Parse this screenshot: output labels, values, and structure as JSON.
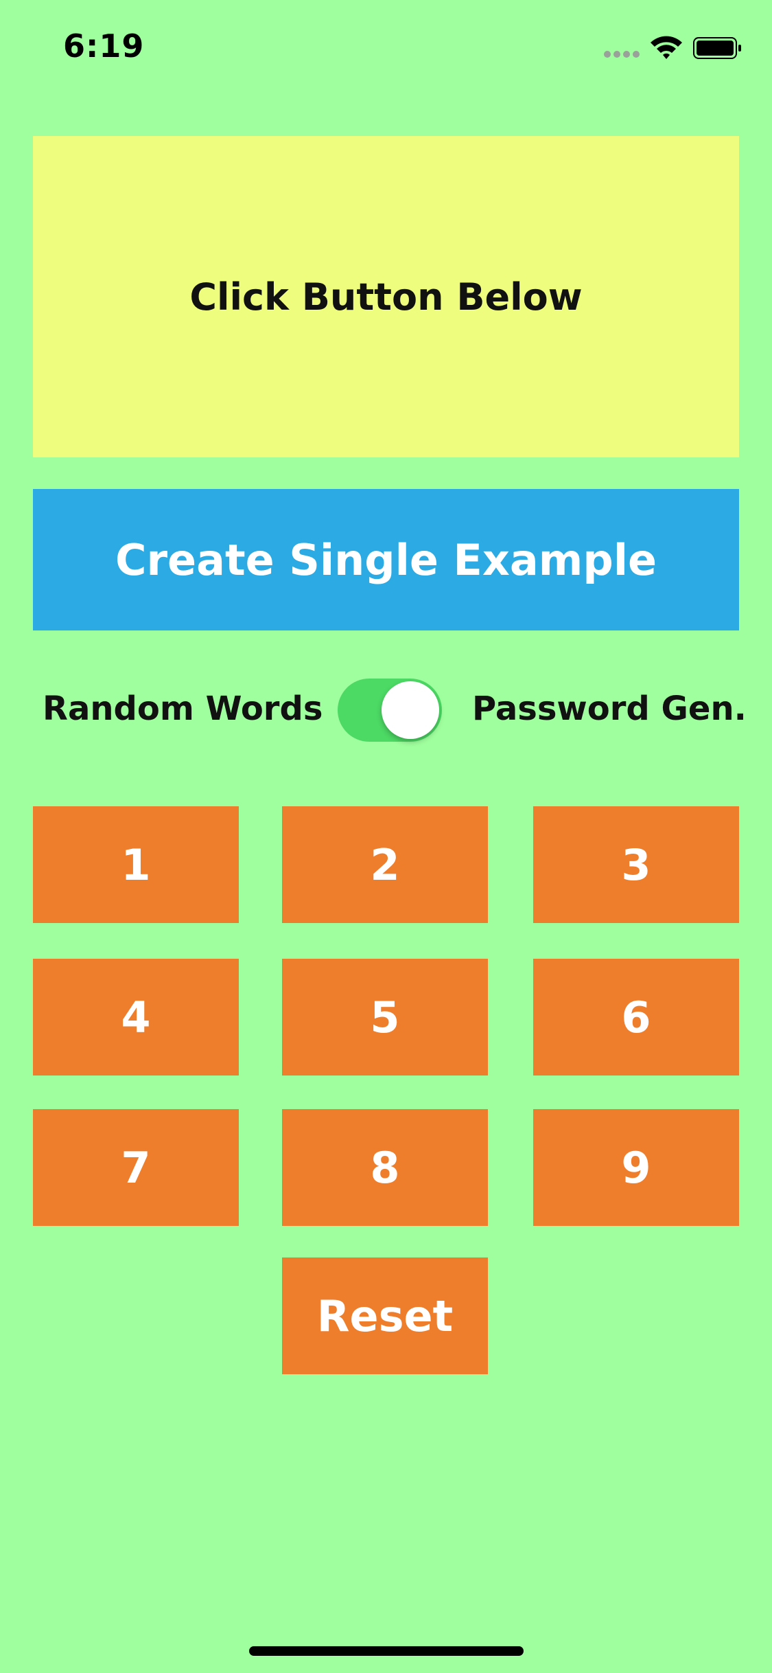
{
  "status_bar": {
    "time": "6:19",
    "icons": [
      "signal-icon",
      "wifi-icon",
      "battery-icon"
    ]
  },
  "display": {
    "text": "Click Button Below"
  },
  "create_button": {
    "label": "Create Single Example"
  },
  "mode_toggle": {
    "left_label": "Random Words",
    "right_label": "Password Gen.",
    "is_on": true
  },
  "keypad": {
    "keys": [
      "1",
      "2",
      "3",
      "4",
      "5",
      "6",
      "7",
      "8",
      "9"
    ],
    "reset_label": "Reset"
  },
  "colors": {
    "background": "#9ffe9d",
    "display_panel": "#effd7e",
    "create_button": "#2baae3",
    "keypad_button": "#ee7d2c",
    "toggle_on": "#4cd964"
  }
}
